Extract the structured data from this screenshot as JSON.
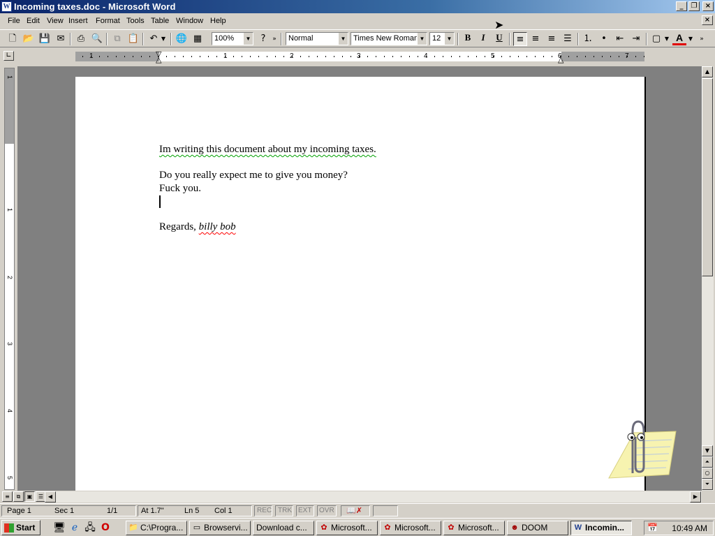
{
  "window": {
    "title": "Incoming taxes.doc - Microsoft Word",
    "app_icon": "W",
    "minimize": "_",
    "maximize": "❐",
    "close": "×"
  },
  "menu": {
    "items": [
      "File",
      "Edit",
      "View",
      "Insert",
      "Format",
      "Tools",
      "Table",
      "Window",
      "Help"
    ],
    "doc_close": "×"
  },
  "toolbar": {
    "zoom": "100%",
    "style": "Normal",
    "font": "Times New Roman",
    "size": "12",
    "bold": "B",
    "italic": "I",
    "underline": "U",
    "font_color_letter": "A"
  },
  "ruler": {
    "numbers": [
      "1",
      "1",
      "2",
      "3",
      "4",
      "5",
      "6",
      "7"
    ],
    "vertical_numbers": [
      "1",
      "1",
      "2",
      "3",
      "4",
      "5"
    ]
  },
  "document": {
    "line1": "Im writing this document about my incoming taxes.",
    "line2": "Do you really expect me to give you money?",
    "line3": "Fuck you.",
    "regards": "Regards, ",
    "signature": "billy bob"
  },
  "status": {
    "page": "Page 1",
    "sec": "Sec 1",
    "pages": "1/1",
    "at": "At 1.7\"",
    "ln": "Ln 5",
    "col": "Col 1",
    "rec": "REC",
    "trk": "TRK",
    "ext": "EXT",
    "ovr": "OVR"
  },
  "taskbar": {
    "start": "Start",
    "tasks": [
      {
        "label": "C:\\Progra...",
        "icon": "folder-icon"
      },
      {
        "label": "Browservi...",
        "icon": "window-icon"
      },
      {
        "label": "Download c...",
        "icon": "window-icon"
      },
      {
        "label": "Microsoft...",
        "icon": "msn-icon"
      },
      {
        "label": "Microsoft...",
        "icon": "msn-icon"
      },
      {
        "label": "Microsoft...",
        "icon": "msn-icon"
      },
      {
        "label": "DOOM",
        "icon": "doom-icon"
      },
      {
        "label": "Incomin...",
        "icon": "word-icon"
      }
    ],
    "clock": "10:49 AM"
  }
}
